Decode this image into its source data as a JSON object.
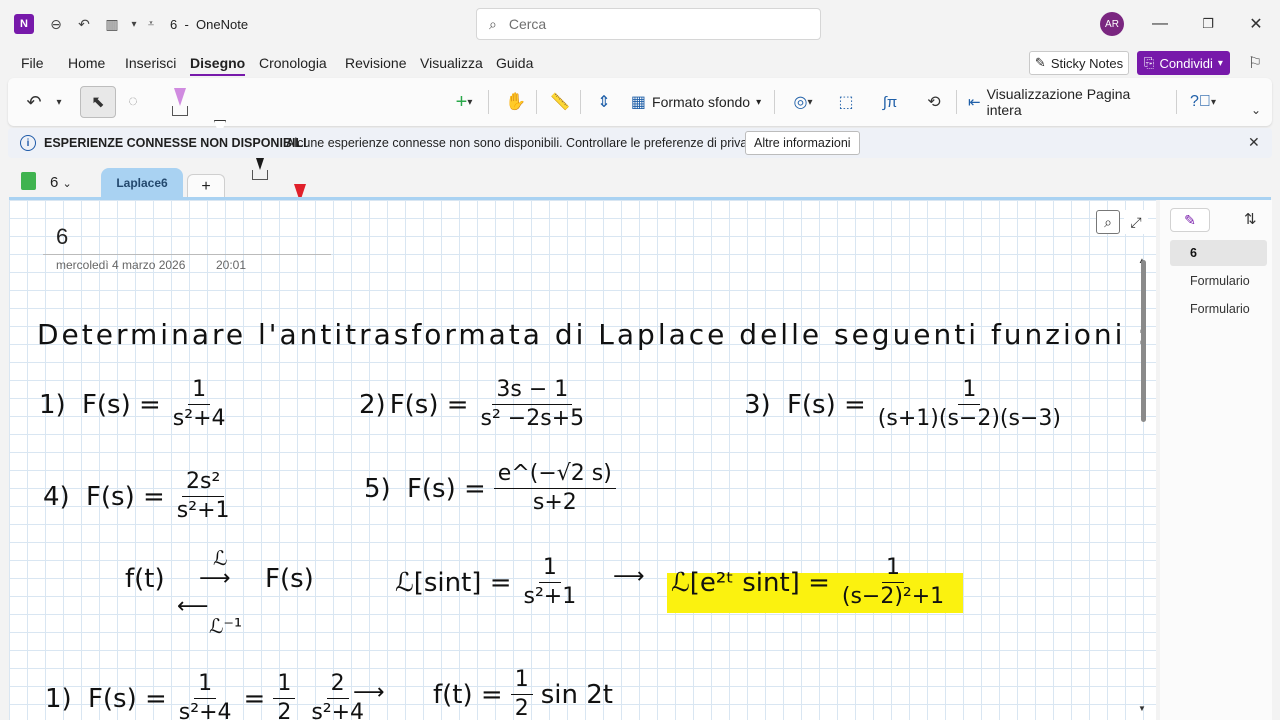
{
  "window": {
    "title_page": "6",
    "title_sep": "-",
    "app_name": "OneNote",
    "logo_letter": "N",
    "search_placeholder": "Cerca",
    "avatar_initials": "AR"
  },
  "menu": {
    "items": [
      "File",
      "Home",
      "Inserisci",
      "Disegno",
      "Cronologia",
      "Revisione",
      "Visualizza",
      "Guida"
    ],
    "active": "Disegno",
    "sticky_notes": "Sticky Notes",
    "share": "Condividi"
  },
  "ribbon": {
    "background_format": "Formato sfondo",
    "full_page_view": "Visualizzazione Pagina intera",
    "pen_colors": [
      "#d08be0",
      "#ffffff",
      "#1a1a1a",
      "#e0202a",
      "#2aa84a",
      "#1f5fa8",
      "#fff33a"
    ]
  },
  "infobar": {
    "title": "ESPERIENZE CONNESSE NON DISPONIBILI",
    "message": "Alcune esperienze connesse non sono disponibili. Controllare le preferenze di privacy.",
    "button": "Altre informazioni"
  },
  "notebook": {
    "name": "6",
    "section": "Laplace6",
    "add_label": "+"
  },
  "page": {
    "title": "6",
    "date": "mercoledì 4 marzo 2026",
    "time": "20:01"
  },
  "ink": {
    "heading": "Determinare l'antitrasformata di Laplace delle seguenti funzioni :",
    "p1_label": "1)",
    "p1_lhs": "F(s) =",
    "p1_num": "1",
    "p1_den": "s²+4",
    "p2_label": "2)",
    "p2_lhs": "F(s) =",
    "p2_num": "3s − 1",
    "p2_den": "s² −2s+5",
    "p3_label": "3)",
    "p3_lhs": "F(s) =",
    "p3_num": "1",
    "p3_den": "(s+1)(s−2)(s−3)",
    "p4_label": "4)",
    "p4_lhs": "F(s) =",
    "p4_num": "2s²",
    "p4_den": "s²+1",
    "p5_label": "5)",
    "p5_lhs": "F(s) =",
    "p5_num": "e^(−√2 s)",
    "p5_den": "s+2",
    "map_f": "f(t)",
    "map_L": "ℒ",
    "map_F": "F(s)",
    "map_Linv": "ℒ⁻¹",
    "sin_lhs": "ℒ[sint] =",
    "sin_num": "1",
    "sin_den": "s²+1",
    "shift_lhs": "ℒ[e²ᵗ sint] =",
    "shift_num": "1",
    "shift_den": "(s−2)²+1",
    "sol1_label": "1)",
    "sol1_lhs": "F(s) =",
    "sol1_num": "1",
    "sol1_den": "s²+4",
    "sol1_eq": "=",
    "sol1_coef_num": "1",
    "sol1_coef_den": "2",
    "sol1_num2": "2",
    "sol1_den2": "s²+4",
    "sol1_result": "f(t) =",
    "sol1_res_num": "1",
    "sol1_res_den": "2",
    "sol1_res_tail": "sin 2t"
  },
  "pages_panel": {
    "items": [
      "6",
      "Formulario",
      "Formulario"
    ],
    "active_index": 0
  }
}
